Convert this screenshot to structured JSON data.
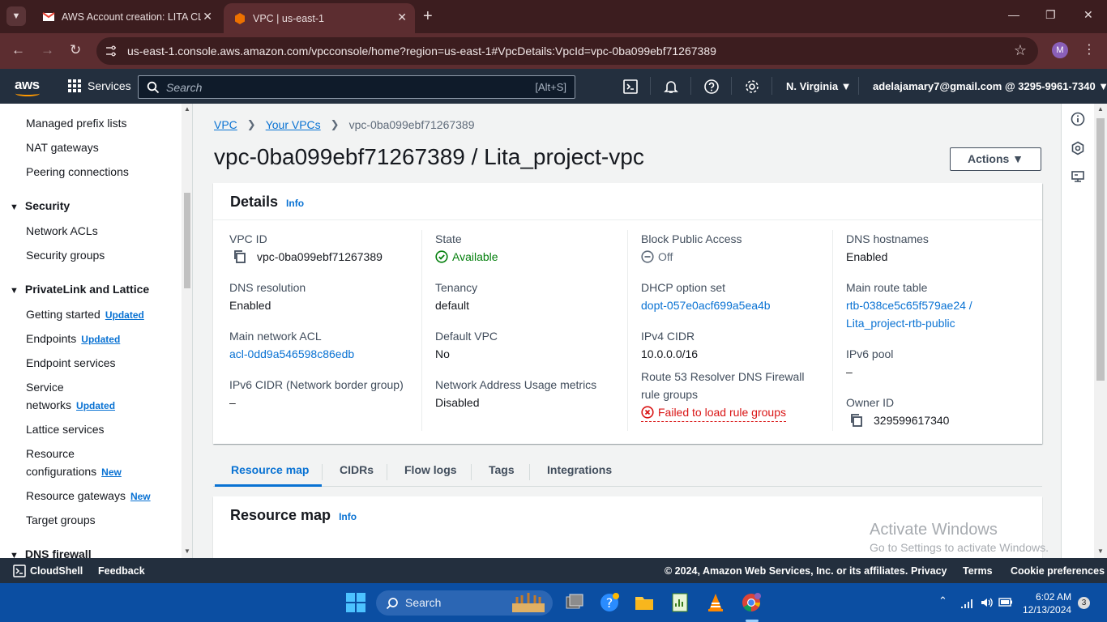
{
  "browser": {
    "tabs": [
      {
        "title": "AWS Account creation: LITA CLOUD"
      },
      {
        "title": "VPC | us-east-1"
      }
    ],
    "url": "us-east-1.console.aws.amazon.com/vpcconsole/home?region=us-east-1#VpcDetails:VpcId=vpc-0ba099ebf71267389",
    "profile_initial": "M"
  },
  "awsnav": {
    "logo": "aws",
    "services_label": "Services",
    "search_placeholder": "Search",
    "search_shortcut": "[Alt+S]",
    "region": "N. Virginia",
    "account": "adelajamary7@gmail.com @ 3295-9961-7340"
  },
  "sidebar": {
    "items_top": [
      "Managed prefix lists",
      "NAT gateways",
      "Peering connections"
    ],
    "security": {
      "title": "Security",
      "items": [
        "Network ACLs",
        "Security groups"
      ]
    },
    "privatelink": {
      "title": "PrivateLink and Lattice",
      "getting_started": "Getting started",
      "endpoints": "Endpoints",
      "endpoint_services": "Endpoint services",
      "service_networks_1": "Service",
      "service_networks_2": "networks",
      "lattice_services": "Lattice services",
      "resource_configurations_1": "Resource",
      "resource_configurations_2": "configurations",
      "resource_gateways": "Resource gateways",
      "target_groups": "Target groups"
    },
    "badge_updated": "Updated",
    "badge_new": "New",
    "dns_firewall": "DNS firewall"
  },
  "main": {
    "breadcrumb": {
      "root": "VPC",
      "parent": "Your VPCs",
      "current": "vpc-0ba099ebf71267389"
    },
    "title": "vpc-0ba099ebf71267389 / Lita_project-vpc",
    "actions_label": "Actions",
    "details": {
      "title": "Details",
      "info": "Info",
      "vpc_id_label": "VPC ID",
      "vpc_id": "vpc-0ba099ebf71267389",
      "dns_resolution_label": "DNS resolution",
      "dns_resolution": "Enabled",
      "main_acl_label": "Main network ACL",
      "main_acl": "acl-0dd9a546598c86edb",
      "ipv6_cidr_label": "IPv6 CIDR (Network border group)",
      "ipv6_cidr": "–",
      "state_label": "State",
      "state": "Available",
      "tenancy_label": "Tenancy",
      "tenancy": "default",
      "default_vpc_label": "Default VPC",
      "default_vpc": "No",
      "nau_label": "Network Address Usage metrics",
      "nau": "Disabled",
      "bpa_label": "Block Public Access",
      "bpa": "Off",
      "dhcp_label": "DHCP option set",
      "dhcp": "dopt-057e0acf699a5ea4b",
      "ipv4_label": "IPv4 CIDR",
      "ipv4": "10.0.0.0/16",
      "r53_label_1": "Route 53 Resolver DNS Firewall",
      "r53_label_2": "rule groups",
      "r53": "Failed to load rule groups",
      "dns_hostnames_label": "DNS hostnames",
      "dns_hostnames": "Enabled",
      "main_rt_label": "Main route table",
      "main_rt_1": "rtb-038ce5c65f579ae24 /",
      "main_rt_2": "Lita_project-rtb-public",
      "ipv6_pool_label": "IPv6 pool",
      "ipv6_pool": "–",
      "owner_label": "Owner ID",
      "owner": "329599617340"
    },
    "tabs": [
      "Resource map",
      "CIDRs",
      "Flow logs",
      "Tags",
      "Integrations"
    ],
    "resource_map": {
      "title": "Resource map",
      "info": "Info"
    }
  },
  "watermark": {
    "line1": "Activate Windows",
    "line2": "Go to Settings to activate Windows."
  },
  "footer": {
    "cloudshell": "CloudShell",
    "feedback": "Feedback",
    "copyright": "© 2024, Amazon Web Services, Inc. or its affiliates.",
    "privacy": "Privacy",
    "terms": "Terms",
    "cookies": "Cookie preferences"
  },
  "taskbar": {
    "search": "Search",
    "time": "6:02 AM",
    "date": "12/13/2024",
    "notifications": "3"
  },
  "colors": {
    "aws_nav": "#232f3e",
    "link": "#0972d3",
    "success": "#037f0c",
    "error": "#d91515",
    "browser_frame": "#3c1d1f"
  }
}
